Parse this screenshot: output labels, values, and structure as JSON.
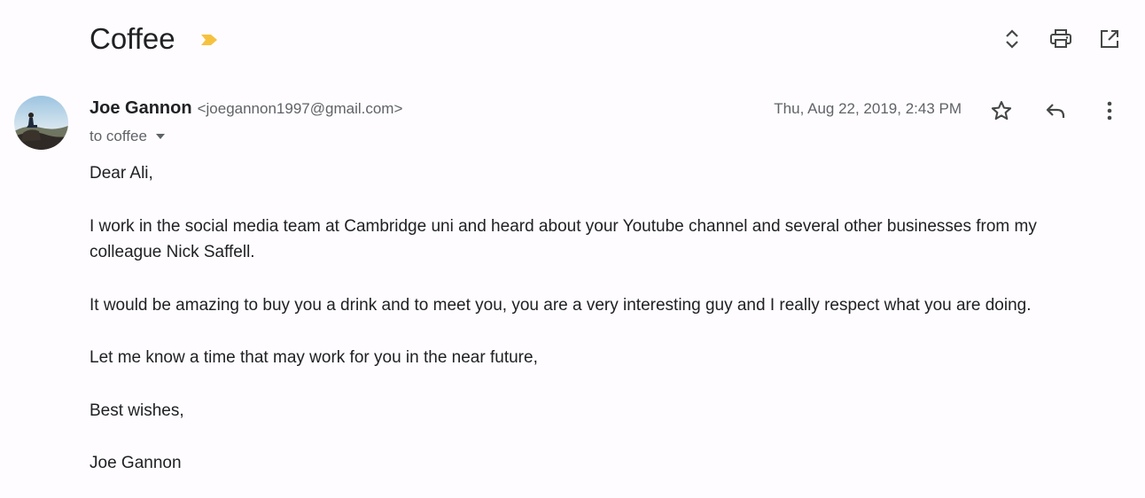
{
  "thread": {
    "subject": "Coffee",
    "importance_color": "#f6c23e"
  },
  "toolbar": {
    "expand_icon": "unfold-icon",
    "print_icon": "print-icon",
    "open_new_window_icon": "open-in-new-icon"
  },
  "message": {
    "sender_name": "Joe Gannon",
    "sender_email": "<joegannon1997@gmail.com>",
    "recipient_label": "to coffee",
    "date": "Thu, Aug 22, 2019, 2:43 PM",
    "actions": [
      "star-icon",
      "reply-icon",
      "more-vert-icon"
    ],
    "body": {
      "greeting": "Dear Ali,",
      "paragraph1": "I work in the social media team at Cambridge uni and heard about your Youtube channel and several other businesses from my colleague Nick Saffell.",
      "paragraph2": "It would be amazing to buy you a drink and to meet you, you are a very interesting guy and I really respect what you are doing.",
      "paragraph3": "Let me know a time that may work for you in the near future,",
      "closing": "Best wishes,",
      "signature": "Joe Gannon"
    }
  }
}
